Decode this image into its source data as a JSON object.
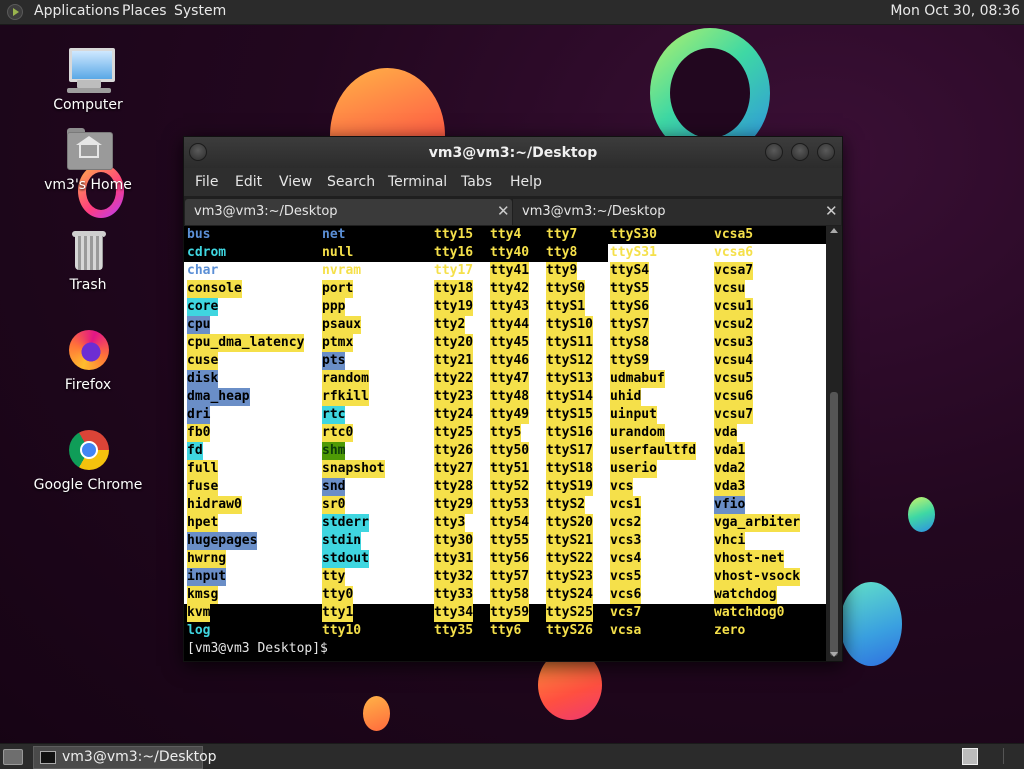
{
  "top_panel": {
    "menus": [
      "Applications",
      "Places",
      "System"
    ],
    "clock": "Mon Oct 30, 08:36"
  },
  "desktop_icons": [
    {
      "label": "Computer",
      "icon": "computer-icon"
    },
    {
      "label": "vm3's Home",
      "icon": "home-folder-icon"
    },
    {
      "label": "Trash",
      "icon": "trash-icon"
    },
    {
      "label": "Firefox",
      "icon": "firefox-icon"
    },
    {
      "label": "Google Chrome",
      "icon": "chrome-icon"
    }
  ],
  "terminal": {
    "title": "vm3@vm3:~/Desktop",
    "menu": [
      "File",
      "Edit",
      "View",
      "Search",
      "Terminal",
      "Tabs",
      "Help"
    ],
    "tabs": [
      {
        "label": "vm3@vm3:~/Desktop",
        "active": true
      },
      {
        "label": "vm3@vm3:~/Desktop",
        "active": false
      }
    ],
    "ls_rows": [
      [
        [
          "bus",
          "db"
        ],
        [
          "net",
          "db"
        ],
        [
          "tty15",
          "dy"
        ],
        [
          "tty4",
          "dy"
        ],
        [
          "tty7",
          "dy"
        ],
        [
          "ttyS30",
          "dy"
        ],
        [
          "vcsa5",
          "dy"
        ]
      ],
      [
        [
          "cdrom",
          "dc"
        ],
        [
          "null",
          "dy"
        ],
        [
          "tty16",
          "dy"
        ],
        [
          "tty40",
          "dy"
        ],
        [
          "tty8",
          "dy"
        ],
        [
          "ttyS31",
          "dy"
        ],
        [
          "vcsa6",
          "dy"
        ]
      ],
      [
        [
          "char",
          "db"
        ],
        [
          "nvram",
          "dy"
        ],
        [
          "tty17",
          "dy"
        ],
        [
          "tty41",
          "y"
        ],
        [
          "tty9",
          "y"
        ],
        [
          "ttyS4",
          "y"
        ],
        [
          "vcsa7",
          "y"
        ]
      ],
      [
        [
          "console",
          "y"
        ],
        [
          "port",
          "y"
        ],
        [
          "tty18",
          "y"
        ],
        [
          "tty42",
          "y"
        ],
        [
          "ttyS0",
          "y"
        ],
        [
          "ttyS5",
          "y"
        ],
        [
          "vcsu",
          "y"
        ]
      ],
      [
        [
          "core",
          "c"
        ],
        [
          "ppp",
          "y"
        ],
        [
          "tty19",
          "y"
        ],
        [
          "tty43",
          "y"
        ],
        [
          "ttyS1",
          "y"
        ],
        [
          "ttyS6",
          "y"
        ],
        [
          "vcsu1",
          "y"
        ]
      ],
      [
        [
          "cpu",
          "b"
        ],
        [
          "psaux",
          "y"
        ],
        [
          "tty2",
          "y"
        ],
        [
          "tty44",
          "y"
        ],
        [
          "ttyS10",
          "y"
        ],
        [
          "ttyS7",
          "y"
        ],
        [
          "vcsu2",
          "y"
        ]
      ],
      [
        [
          "cpu_dma_latency",
          "y"
        ],
        [
          "ptmx",
          "y"
        ],
        [
          "tty20",
          "y"
        ],
        [
          "tty45",
          "y"
        ],
        [
          "ttyS11",
          "y"
        ],
        [
          "ttyS8",
          "y"
        ],
        [
          "vcsu3",
          "y"
        ]
      ],
      [
        [
          "cuse",
          "y"
        ],
        [
          "pts",
          "b"
        ],
        [
          "tty21",
          "y"
        ],
        [
          "tty46",
          "y"
        ],
        [
          "ttyS12",
          "y"
        ],
        [
          "ttyS9",
          "y"
        ],
        [
          "vcsu4",
          "y"
        ]
      ],
      [
        [
          "disk",
          "b"
        ],
        [
          "random",
          "y"
        ],
        [
          "tty22",
          "y"
        ],
        [
          "tty47",
          "y"
        ],
        [
          "ttyS13",
          "y"
        ],
        [
          "udmabuf",
          "y"
        ],
        [
          "vcsu5",
          "y"
        ]
      ],
      [
        [
          "dma_heap",
          "b"
        ],
        [
          "rfkill",
          "y"
        ],
        [
          "tty23",
          "y"
        ],
        [
          "tty48",
          "y"
        ],
        [
          "ttyS14",
          "y"
        ],
        [
          "uhid",
          "y"
        ],
        [
          "vcsu6",
          "y"
        ]
      ],
      [
        [
          "dri",
          "b"
        ],
        [
          "rtc",
          "c"
        ],
        [
          "tty24",
          "y"
        ],
        [
          "tty49",
          "y"
        ],
        [
          "ttyS15",
          "y"
        ],
        [
          "uinput",
          "y"
        ],
        [
          "vcsu7",
          "y"
        ]
      ],
      [
        [
          "fb0",
          "y"
        ],
        [
          "rtc0",
          "y"
        ],
        [
          "tty25",
          "y"
        ],
        [
          "tty5",
          "y"
        ],
        [
          "ttyS16",
          "y"
        ],
        [
          "urandom",
          "y"
        ],
        [
          "vda",
          "y"
        ]
      ],
      [
        [
          "fd",
          "c"
        ],
        [
          "shm",
          "g"
        ],
        [
          "tty26",
          "y"
        ],
        [
          "tty50",
          "y"
        ],
        [
          "ttyS17",
          "y"
        ],
        [
          "userfaultfd",
          "y"
        ],
        [
          "vda1",
          "y"
        ]
      ],
      [
        [
          "full",
          "y"
        ],
        [
          "snapshot",
          "y"
        ],
        [
          "tty27",
          "y"
        ],
        [
          "tty51",
          "y"
        ],
        [
          "ttyS18",
          "y"
        ],
        [
          "userio",
          "y"
        ],
        [
          "vda2",
          "y"
        ]
      ],
      [
        [
          "fuse",
          "y"
        ],
        [
          "snd",
          "b"
        ],
        [
          "tty28",
          "y"
        ],
        [
          "tty52",
          "y"
        ],
        [
          "ttyS19",
          "y"
        ],
        [
          "vcs",
          "y"
        ],
        [
          "vda3",
          "y"
        ]
      ],
      [
        [
          "hidraw0",
          "y"
        ],
        [
          "sr0",
          "y"
        ],
        [
          "tty29",
          "y"
        ],
        [
          "tty53",
          "y"
        ],
        [
          "ttyS2",
          "y"
        ],
        [
          "vcs1",
          "y"
        ],
        [
          "vfio",
          "b"
        ]
      ],
      [
        [
          "hpet",
          "y"
        ],
        [
          "stderr",
          "c"
        ],
        [
          "tty3",
          "y"
        ],
        [
          "tty54",
          "y"
        ],
        [
          "ttyS20",
          "y"
        ],
        [
          "vcs2",
          "y"
        ],
        [
          "vga_arbiter",
          "y"
        ]
      ],
      [
        [
          "hugepages",
          "b"
        ],
        [
          "stdin",
          "c"
        ],
        [
          "tty30",
          "y"
        ],
        [
          "tty55",
          "y"
        ],
        [
          "ttyS21",
          "y"
        ],
        [
          "vcs3",
          "y"
        ],
        [
          "vhci",
          "y"
        ]
      ],
      [
        [
          "hwrng",
          "y"
        ],
        [
          "stdout",
          "c"
        ],
        [
          "tty31",
          "y"
        ],
        [
          "tty56",
          "y"
        ],
        [
          "ttyS22",
          "y"
        ],
        [
          "vcs4",
          "y"
        ],
        [
          "vhost-net",
          "y"
        ]
      ],
      [
        [
          "input",
          "b"
        ],
        [
          "tty",
          "y"
        ],
        [
          "tty32",
          "y"
        ],
        [
          "tty57",
          "y"
        ],
        [
          "ttyS23",
          "y"
        ],
        [
          "vcs5",
          "y"
        ],
        [
          "vhost-vsock",
          "y"
        ]
      ],
      [
        [
          "kmsg",
          "y"
        ],
        [
          "tty0",
          "y"
        ],
        [
          "tty33",
          "y"
        ],
        [
          "tty58",
          "y"
        ],
        [
          "ttyS24",
          "y"
        ],
        [
          "vcs6",
          "y"
        ],
        [
          "watchdog",
          "y"
        ]
      ],
      [
        [
          "kvm",
          "y"
        ],
        [
          "tty1",
          "y"
        ],
        [
          "tty34",
          "y"
        ],
        [
          "tty59",
          "y"
        ],
        [
          "ttyS25",
          "y"
        ],
        [
          "vcs7",
          "dy"
        ],
        [
          "watchdog0",
          "dy"
        ]
      ],
      [
        [
          "log",
          "dc"
        ],
        [
          "tty10",
          "dy"
        ],
        [
          "tty35",
          "dy"
        ],
        [
          "tty6",
          "dy"
        ],
        [
          "ttyS26",
          "dy"
        ],
        [
          "vcsa",
          "dy"
        ],
        [
          "zero",
          "dy"
        ]
      ]
    ],
    "prompt": "[vm3@vm3 Desktop]$ "
  },
  "taskbar": {
    "window_label": "vm3@vm3:~/Desktop"
  }
}
